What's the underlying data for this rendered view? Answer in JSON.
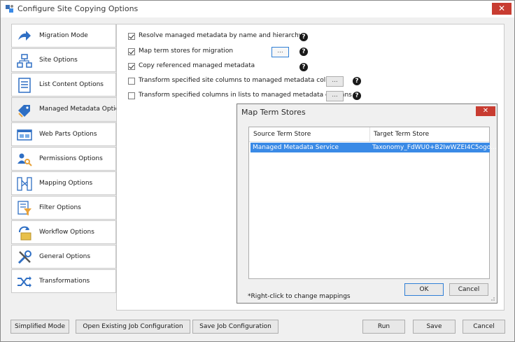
{
  "window": {
    "title": "Configure Site Copying Options",
    "close": "✕"
  },
  "sidebar": {
    "items": [
      {
        "label": "Migration Mode",
        "icon": "arrow-icon"
      },
      {
        "label": "Site Options",
        "icon": "sitemap-icon"
      },
      {
        "label": "List Content Options",
        "icon": "list-icon"
      },
      {
        "label": "Managed Metadata Options",
        "icon": "tag-icon",
        "active": true
      },
      {
        "label": "Web Parts Options",
        "icon": "webpart-icon"
      },
      {
        "label": "Permissions Options",
        "icon": "users-key-icon"
      },
      {
        "label": "Mapping Options",
        "icon": "mapping-icon"
      },
      {
        "label": "Filter Options",
        "icon": "filter-icon"
      },
      {
        "label": "Workflow Options",
        "icon": "workflow-icon"
      },
      {
        "label": "General Options",
        "icon": "tools-icon"
      },
      {
        "label": "Transformations",
        "icon": "shuffle-icon"
      }
    ]
  },
  "options": [
    {
      "label": "Resolve managed metadata by name and hierarchy",
      "checked": true
    },
    {
      "label": "Map term stores for migration",
      "checked": true,
      "button": "..."
    },
    {
      "label": "Copy referenced managed metadata",
      "checked": true
    },
    {
      "label": "Transform specified site columns to managed metadata columns",
      "checked": false,
      "button": "..."
    },
    {
      "label": "Transform specified columns in lists to managed metadata columns",
      "checked": false,
      "button": "..."
    }
  ],
  "help_glyph": "?",
  "dialog": {
    "title": "Map Term Stores",
    "close": "✕",
    "columns": [
      "Source Term Store",
      "Target Term Store"
    ],
    "rows": [
      {
        "source": "Managed Metadata Service",
        "target": "Taxonomy_FdWU0+B2IwWZEI4C5ogo..."
      }
    ],
    "note": "*Right-click to change mappings",
    "ok": "OK",
    "cancel": "Cancel"
  },
  "footer": {
    "simplified": "Simplified Mode",
    "open": "Open Existing Job Configuration",
    "save_config": "Save Job Configuration",
    "run": "Run",
    "save": "Save",
    "cancel": "Cancel"
  },
  "colors": {
    "accent": "#3a8ae6",
    "close": "#c83c31"
  }
}
